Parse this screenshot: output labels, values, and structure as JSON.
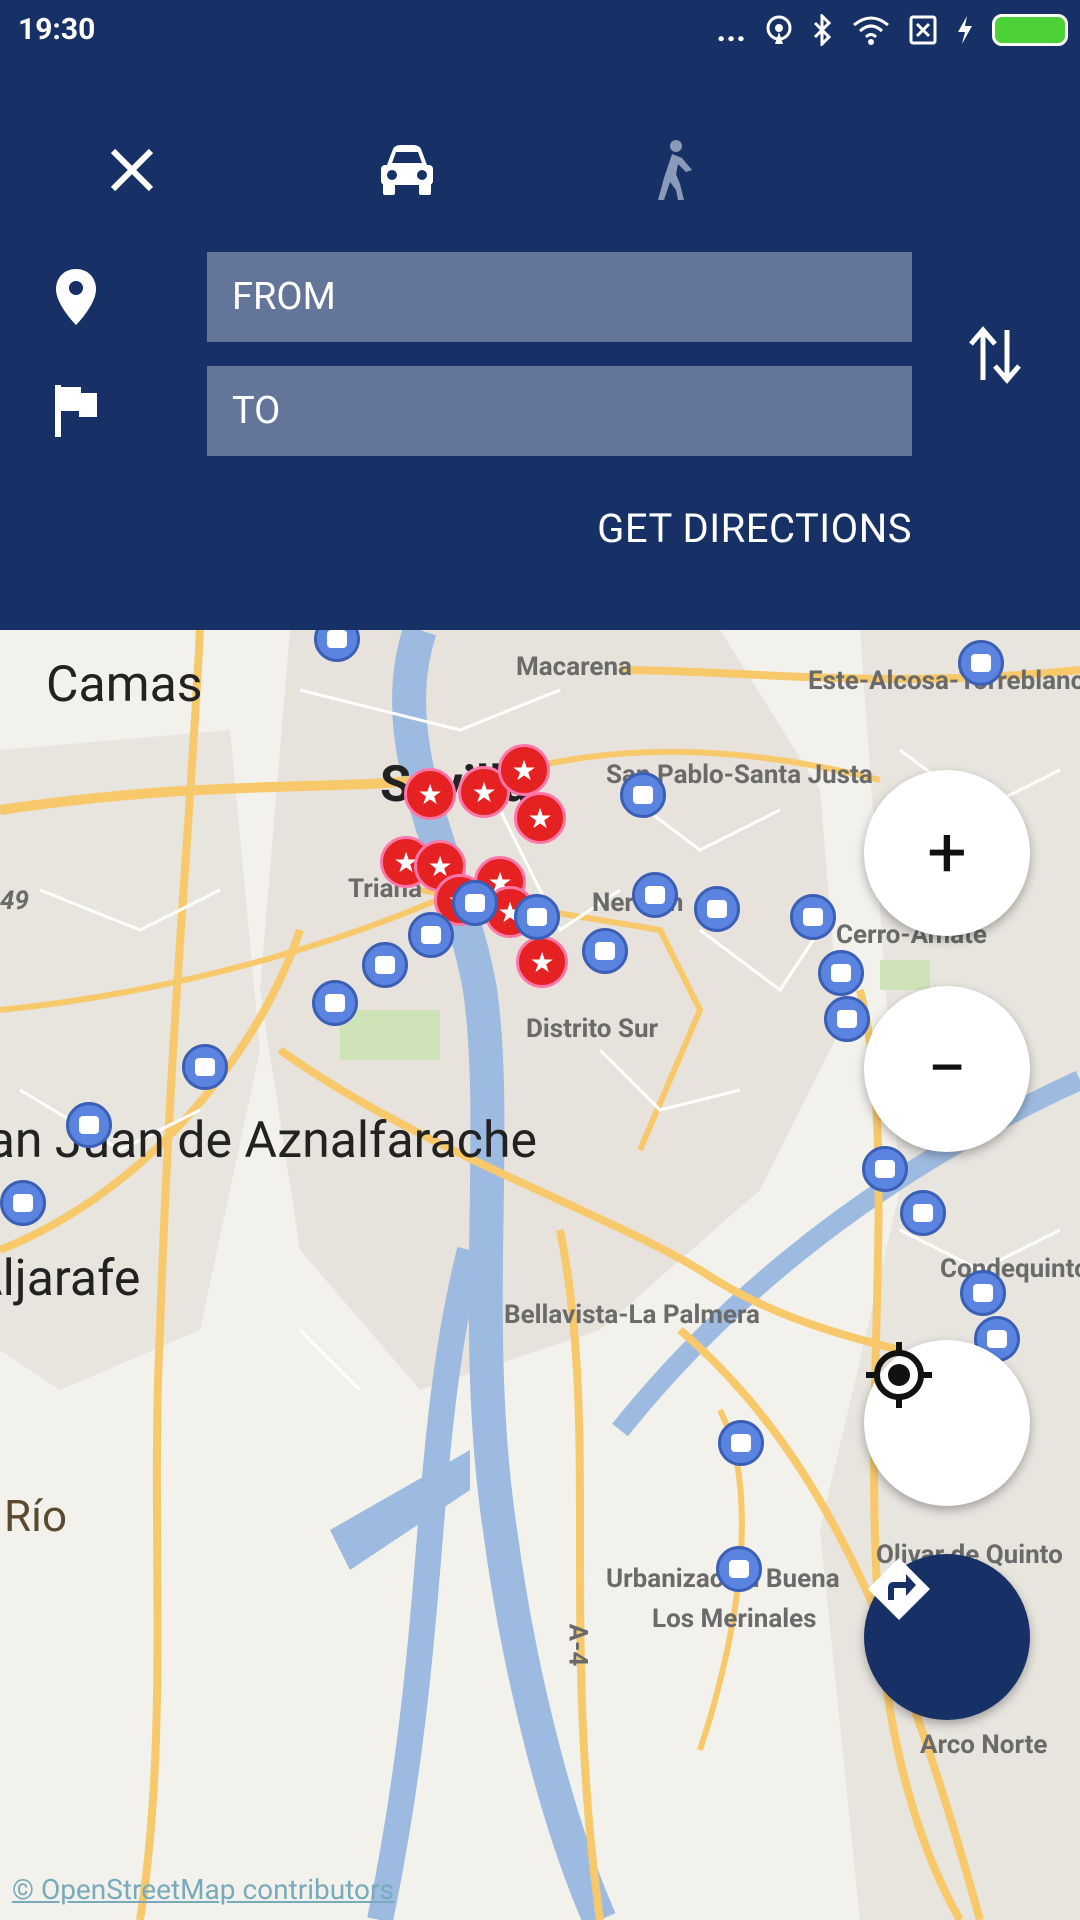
{
  "status_bar": {
    "time": "19:30",
    "dots": "..."
  },
  "header": {
    "from_placeholder": "FROM",
    "to_placeholder": "TO",
    "get_directions_label": "GET DIRECTIONS",
    "modes": [
      "close-icon",
      "car-icon",
      "walk-icon"
    ]
  },
  "map": {
    "labels": {
      "camas": "Camas",
      "sevilla": "Sevilla",
      "triana": "Triana",
      "macarena": "Macarena",
      "este_alcosa": "Este-Alcosa-Torreblanca",
      "san_pablo": "San Pablo-Santa Justa",
      "nervion": "Nervión",
      "cerro_amate": "Cerro-Amate",
      "distrito_sur": "Distrito Sur",
      "aznalfarache": "San Juan de Aznalfarache",
      "aljarafe": "Aljarafe",
      "condequinto": "Condequinto",
      "bellavista": "Bellavista-La Palmera",
      "rio": "Río",
      "urb_buena": "Urbanización Buena",
      "los_merinales": "Los Merinales",
      "olivar": "Olivar de Quinto",
      "arco_norte": "Arco Norte",
      "a4": "A-4",
      "a49": "49"
    },
    "attribution": "© OpenStreetMap contributors"
  },
  "controls": {
    "zoom_in": "+",
    "zoom_out": "−"
  }
}
